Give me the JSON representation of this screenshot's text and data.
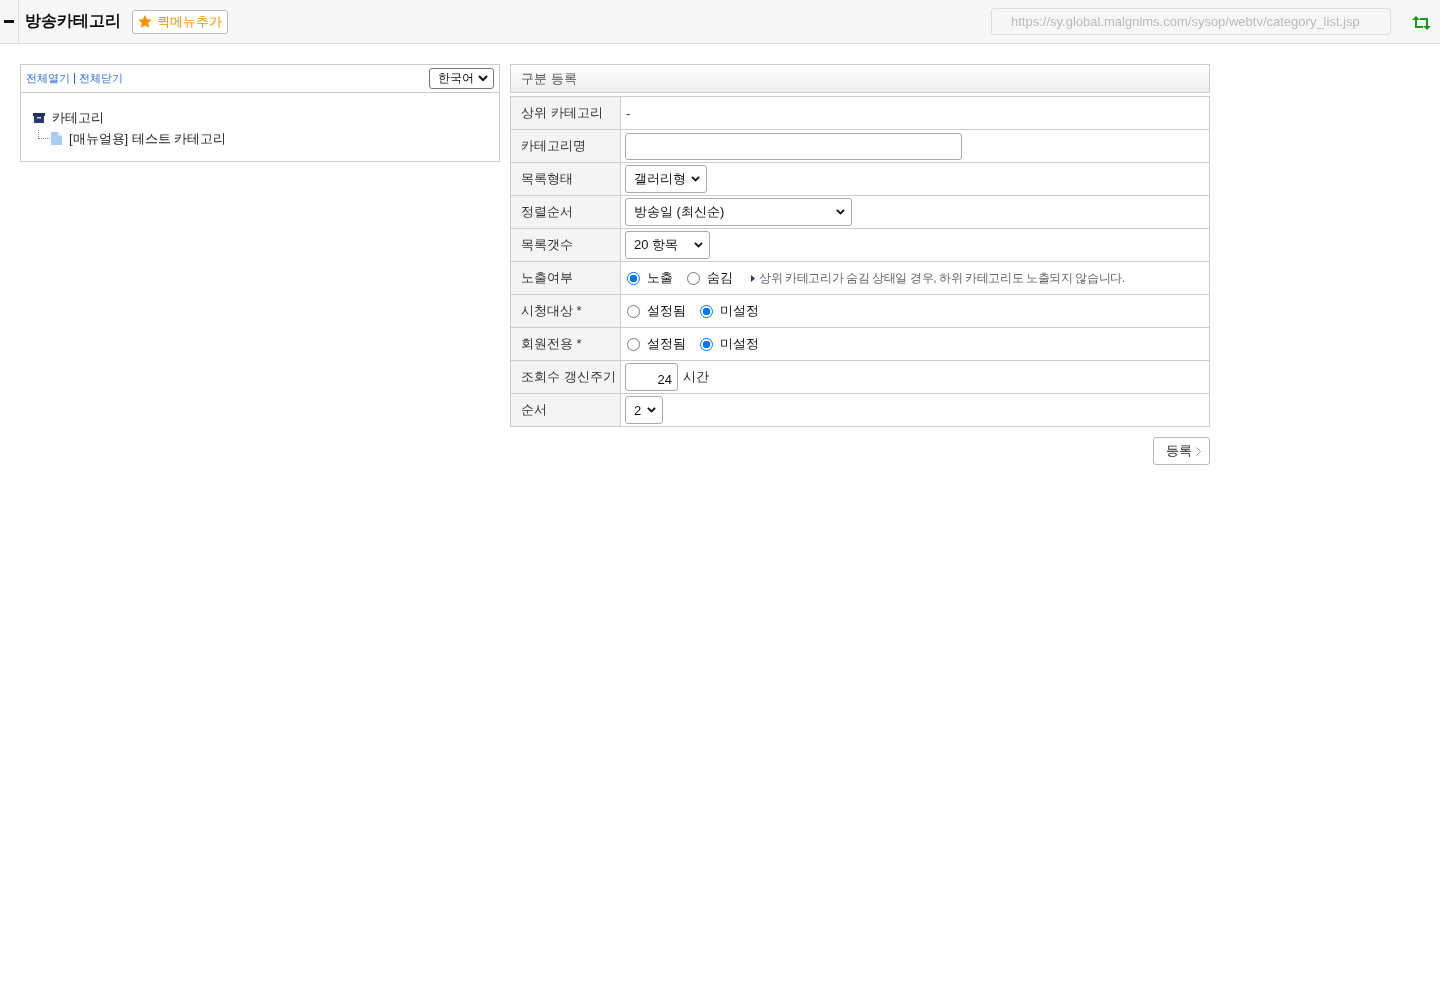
{
  "header": {
    "title": "방송카테고리",
    "quick_menu_button": "퀵메뉴추가",
    "url": "https://sy.global.malgnlms.com/sysop/webtv/category_list.jsp"
  },
  "tree_panel": {
    "expand_all": "전체열기",
    "collapse_all": "전체닫기",
    "language": "한국어",
    "tree": [
      {
        "label": "카테고리",
        "children": [
          {
            "label": "[매뉴얼용] 테스트 카테고리"
          }
        ]
      }
    ]
  },
  "form": {
    "title": "구분 등록",
    "rows": [
      {
        "kind": "text",
        "label": "상위 카테고리",
        "value": "-"
      },
      {
        "kind": "input",
        "label": "카테고리명"
      },
      {
        "kind": "select",
        "label": "목록형태",
        "value": "갤러리형"
      },
      {
        "kind": "select",
        "label": "정렬순서",
        "value": "방송일 (최신순)"
      },
      {
        "kind": "select",
        "label": "목록갯수",
        "value": "20 항목"
      },
      {
        "kind": "radio",
        "label": "노출여부",
        "options": [
          {
            "label": "노출",
            "selected": true
          },
          {
            "label": "숨김",
            "selected": false
          }
        ],
        "note": "상위 카테고리가 숨김 상태일 경우, 하위 카테고리도 노출되지 않습니다."
      },
      {
        "kind": "radio",
        "label": "시청대상 *",
        "options": [
          {
            "label": "설정됨",
            "selected": false
          },
          {
            "label": "미설정",
            "selected": true
          }
        ]
      },
      {
        "kind": "radio",
        "label": "회원전용 *",
        "options": [
          {
            "label": "설정됨",
            "selected": false
          },
          {
            "label": "미설정",
            "selected": true
          }
        ]
      },
      {
        "kind": "number",
        "label": "조회수 갱신주기",
        "value": "24",
        "unit": "시간"
      },
      {
        "kind": "select",
        "label": "순서",
        "value": "2"
      }
    ]
  },
  "submit_button": "등록"
}
